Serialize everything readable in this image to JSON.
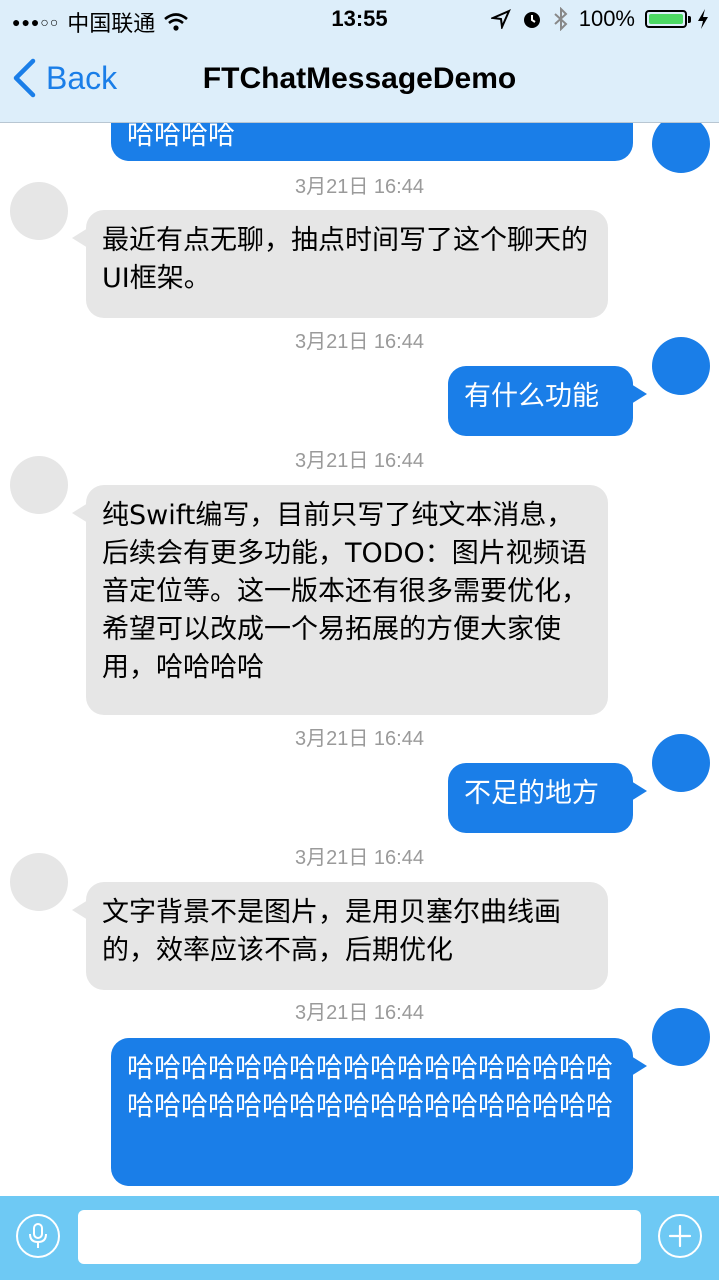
{
  "status_bar": {
    "carrier": "中国联通",
    "time": "13:55",
    "battery": "100%",
    "battery_level": 1.0
  },
  "nav": {
    "back_label": "Back",
    "title": "FTChatMessageDemo"
  },
  "messages": [
    {
      "side": "out",
      "time": "",
      "text": "哈哈哈哈"
    },
    {
      "side": "in",
      "time": "3月21日 16:44",
      "text": "最近有点无聊，抽点时间写了这个聊天的UI框架。"
    },
    {
      "side": "out",
      "time": "3月21日 16:44",
      "text": "有什么功能"
    },
    {
      "side": "in",
      "time": "3月21日 16:44",
      "text": "纯Swift编写，目前只写了纯文本消息，后续会有更多功能，TODO：图片视频语音定位等。这一版本还有很多需要优化，希望可以改成一个易拓展的方便大家使用，哈哈哈哈"
    },
    {
      "side": "out",
      "time": "3月21日 16:44",
      "text": "不足的地方"
    },
    {
      "side": "in",
      "time": "3月21日 16:44",
      "text": "文字背景不是图片，是用贝塞尔曲线画的，效率应该不高，后期优化"
    },
    {
      "side": "out",
      "time": "3月21日 16:44",
      "text": "哈哈哈哈哈哈哈哈哈哈哈哈哈哈哈哈哈哈哈哈哈哈哈哈哈哈哈哈哈哈哈哈哈哈哈哈"
    }
  ],
  "input_bar": {
    "input_value": "",
    "mic_icon": "microphone-icon",
    "add_icon": "plus-icon"
  },
  "colors": {
    "bar_background": "#ddeefa",
    "accent": "#1a7ee8",
    "incoming_bubble": "#e6e6e6",
    "input_bar": "#6ec9f4"
  }
}
